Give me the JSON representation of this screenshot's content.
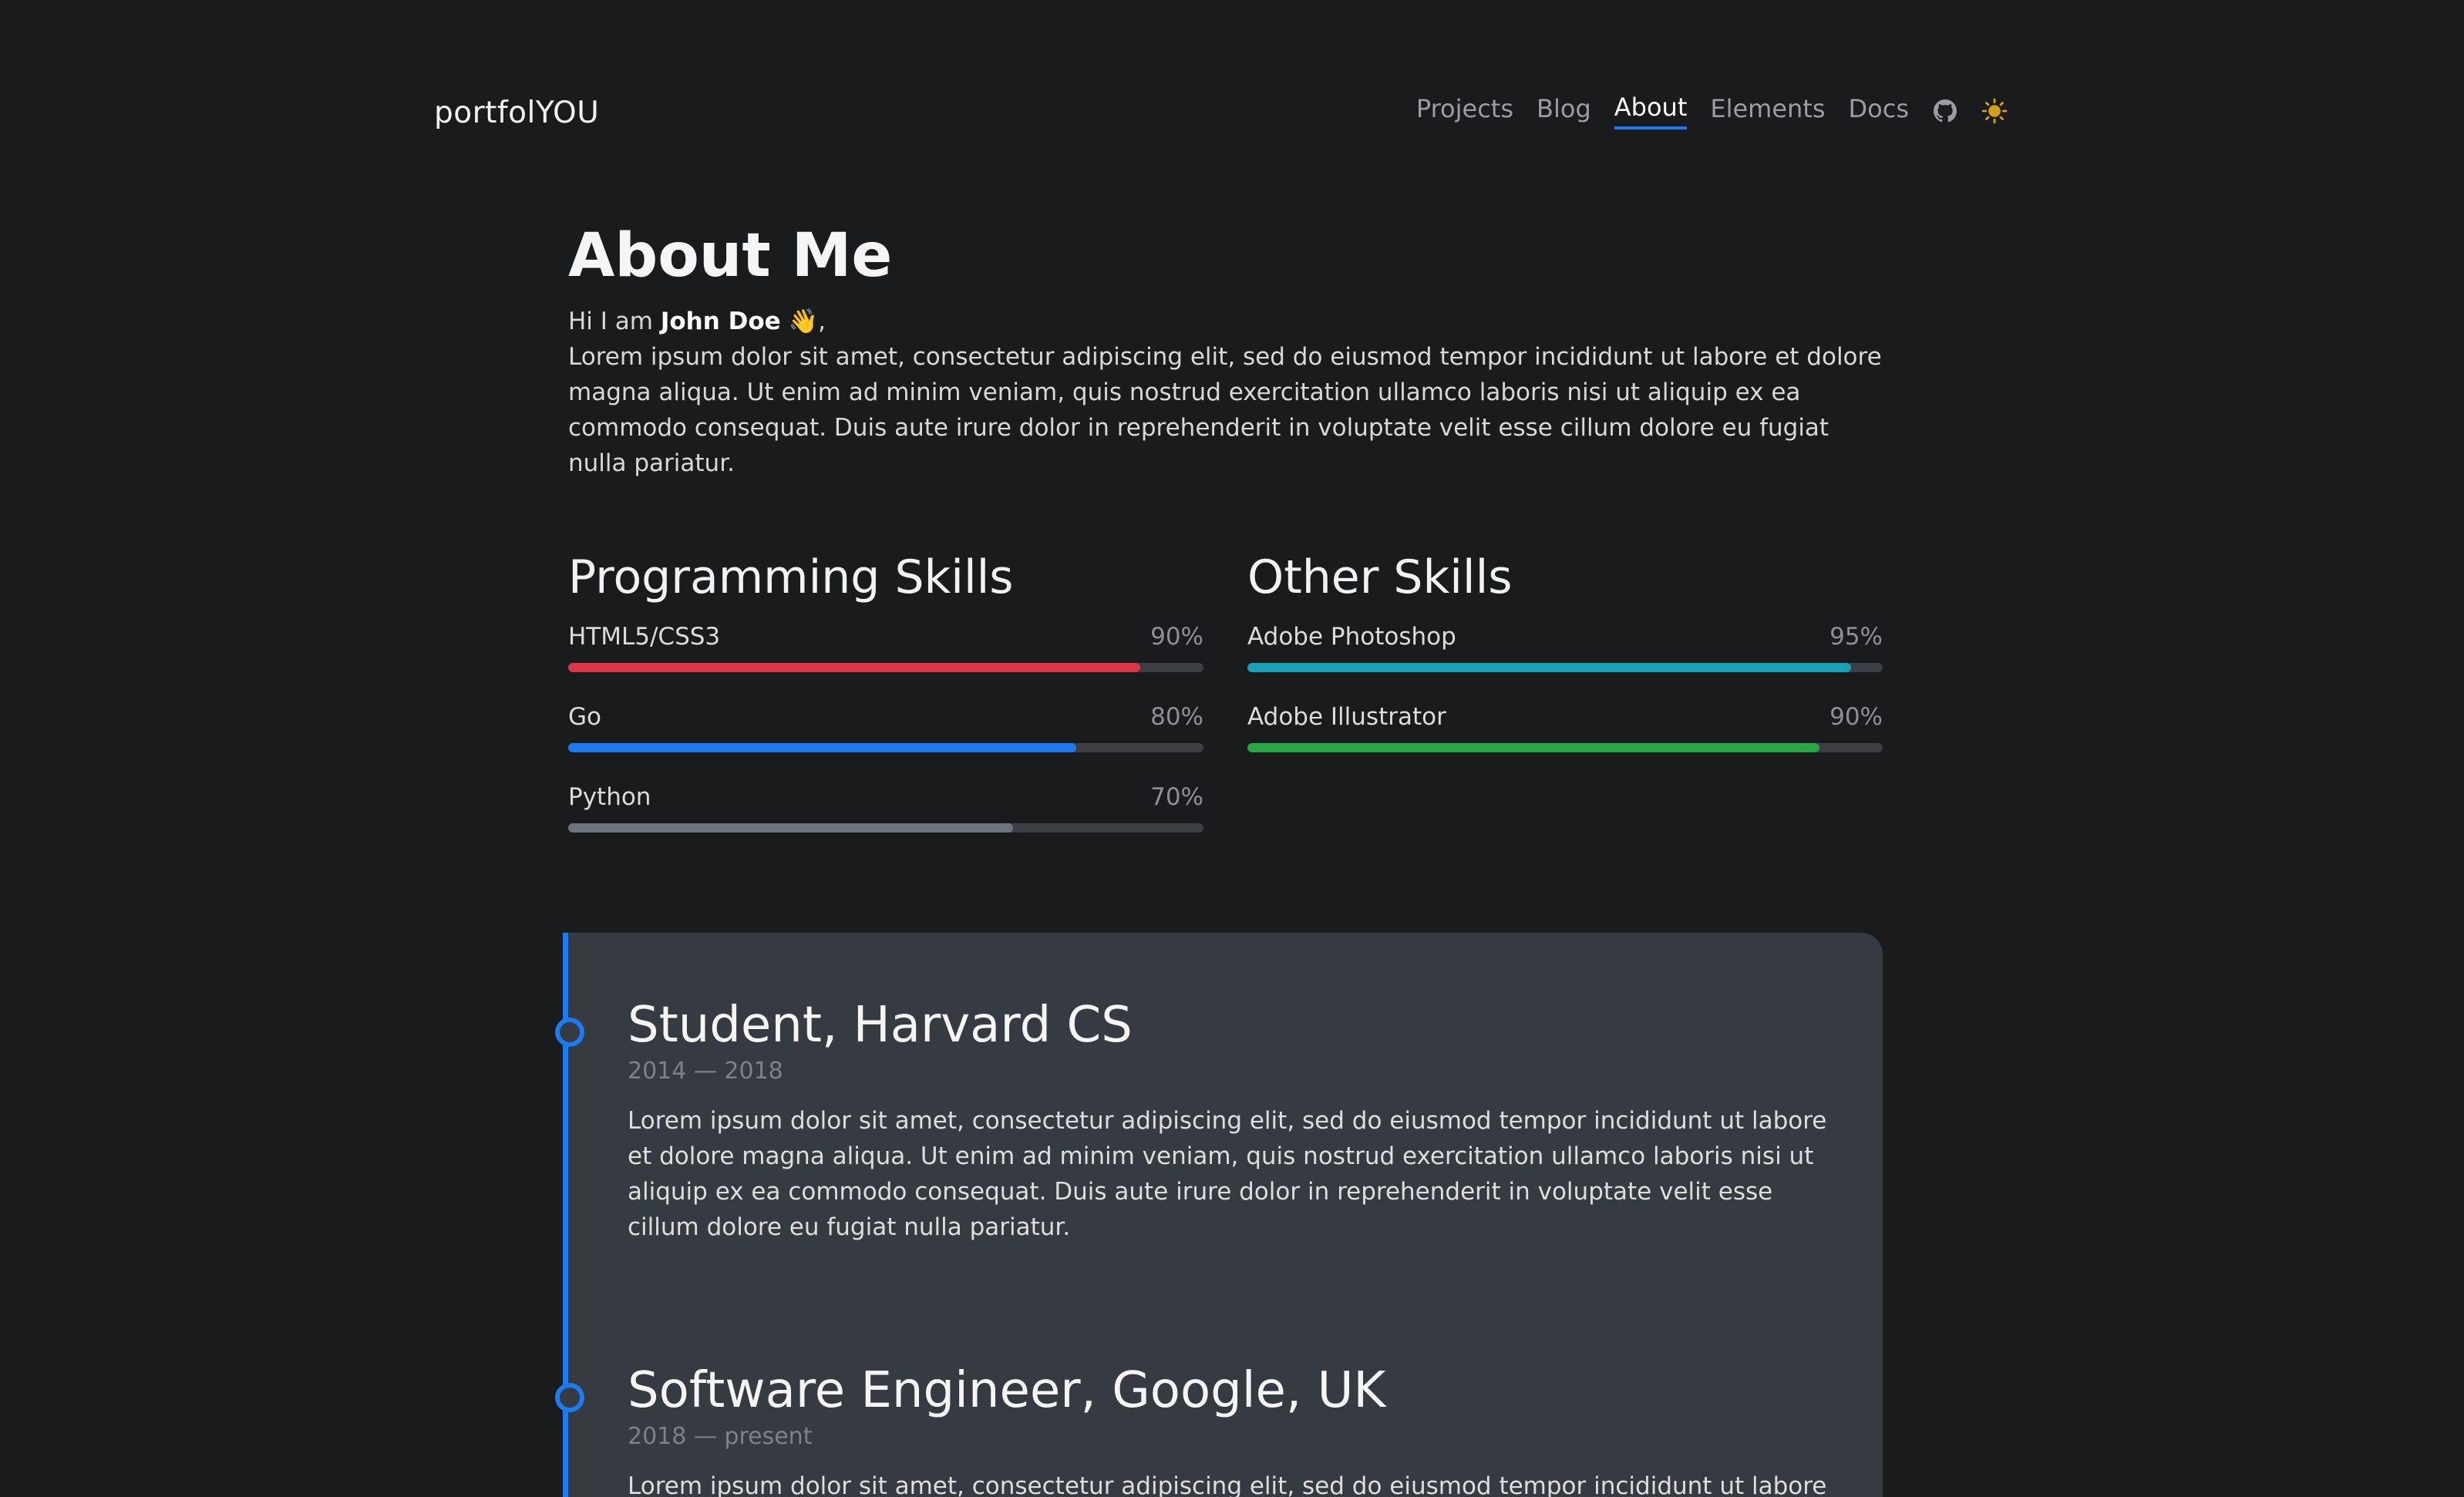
{
  "header": {
    "brand": "portfolYOU",
    "nav": [
      "Projects",
      "Blog",
      "About",
      "Elements",
      "Docs"
    ],
    "active": "About"
  },
  "about": {
    "title": "About Me",
    "greeting_prefix": "Hi I am ",
    "name": "John Doe",
    "greeting_suffix": " 👋,",
    "body": "Lorem ipsum dolor sit amet, consectetur adipiscing elit, sed do eiusmod tempor incididunt ut labore et dolore magna aliqua. Ut enim ad minim veniam, quis nostrud exercitation ullamco laboris nisi ut aliquip ex ea commodo consequat. Duis aute irure dolor in reprehenderit in voluptate velit esse cillum dolore eu fugiat nulla pariatur."
  },
  "programming_skills": {
    "title": "Programming Skills",
    "items": [
      {
        "name": "HTML5/CSS3",
        "percent_label": "90%",
        "level": 0.9,
        "color": "#dc3545"
      },
      {
        "name": "Go",
        "percent_label": "80%",
        "level": 0.8,
        "color": "#1d7bf2"
      },
      {
        "name": "Python",
        "percent_label": "70%",
        "level": 0.7,
        "color": "#6c757d"
      }
    ]
  },
  "other_skills": {
    "title": "Other Skills",
    "items": [
      {
        "name": "Adobe Photoshop",
        "percent_label": "95%",
        "level": 0.95,
        "color": "#17a2b8"
      },
      {
        "name": "Adobe Illustrator",
        "percent_label": "90%",
        "level": 0.9,
        "color": "#28a745"
      }
    ]
  },
  "timeline": [
    {
      "title": "Student, Harvard CS",
      "dates": "2014 — 2018",
      "body": "Lorem ipsum dolor sit amet, consectetur adipiscing elit, sed do eiusmod tempor incididunt ut labore et dolore magna aliqua. Ut enim ad minim veniam, quis nostrud exercitation ullamco laboris nisi ut aliquip ex ea commodo consequat. Duis aute irure dolor in reprehenderit in voluptate velit esse cillum dolore eu fugiat nulla pariatur."
    },
    {
      "title": "Software Engineer, Google, UK",
      "dates": "2018 — present",
      "body": "Lorem ipsum dolor sit amet, consectetur adipiscing elit, sed do eiusmod tempor incididunt ut labore"
    }
  ],
  "icons": {
    "github": "github-icon",
    "theme": "sun-icon"
  },
  "colors": {
    "accent": "#1d7bf2",
    "background": "#1a1b1d",
    "card": "#363a41",
    "sun": "#d4a017"
  }
}
